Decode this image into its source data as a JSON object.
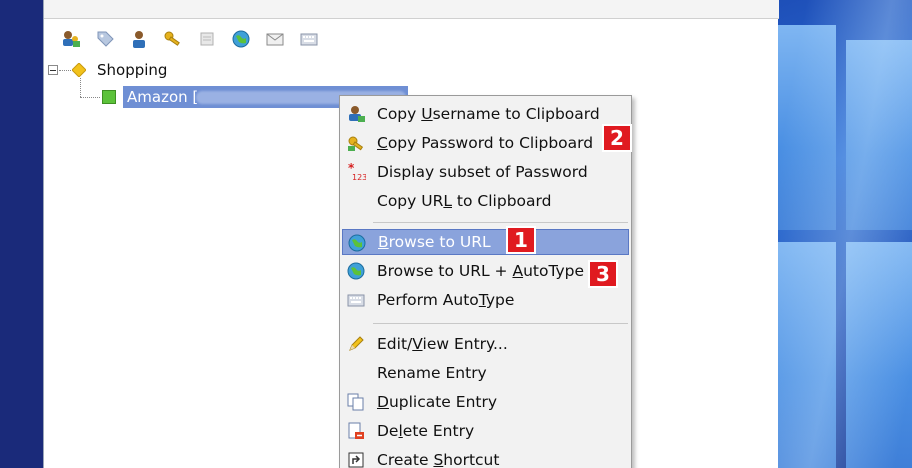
{
  "toolbar": {
    "buttons": [
      {
        "name": "copy-username-tb-icon"
      },
      {
        "name": "tag-icon"
      },
      {
        "name": "user-icon"
      },
      {
        "name": "key-icon"
      },
      {
        "name": "note-icon"
      },
      {
        "name": "globe-icon"
      },
      {
        "name": "email-icon"
      },
      {
        "name": "keyboard-icon"
      }
    ]
  },
  "tree": {
    "group_label": "Shopping",
    "entry_label": "Amazon ["
  },
  "menu": {
    "items": [
      {
        "pre": "Copy ",
        "u": "U",
        "post": "sername to Clipboard"
      },
      {
        "pre": "",
        "u": "C",
        "post": "opy Password to Clipboard"
      },
      {
        "pre": "Display subset of Password",
        "u": "",
        "post": ""
      },
      {
        "pre": "Copy UR",
        "u": "L",
        "post": " to Clipboard"
      },
      {
        "pre": "",
        "u": "B",
        "post": "rowse to URL"
      },
      {
        "pre": "Browse to URL + ",
        "u": "A",
        "post": "utoType"
      },
      {
        "pre": "Perform Auto",
        "u": "T",
        "post": "ype"
      },
      {
        "pre": "Edit/",
        "u": "V",
        "post": "iew Entry..."
      },
      {
        "pre": "Rename Entry",
        "u": "",
        "post": ""
      },
      {
        "pre": "",
        "u": "D",
        "post": "uplicate Entry"
      },
      {
        "pre": "De",
        "u": "l",
        "post": "ete Entry"
      },
      {
        "pre": "Create ",
        "u": "S",
        "post": "hortcut"
      }
    ]
  },
  "badges": [
    "1",
    "2",
    "3"
  ],
  "colors": {
    "selection": "#8aa3dc",
    "badge": "#e01a20",
    "tree_selection": "#6f8fd4"
  }
}
